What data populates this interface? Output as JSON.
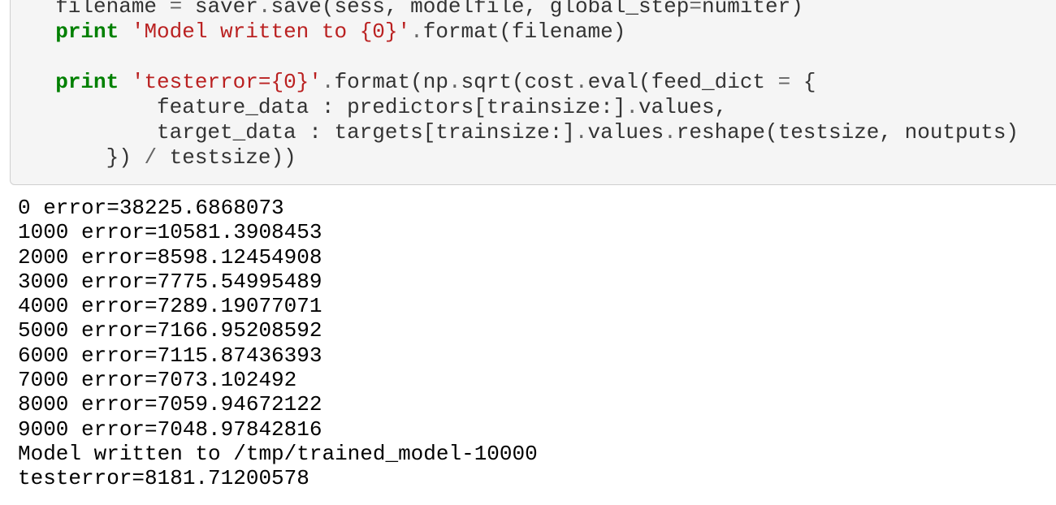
{
  "input_cell": {
    "code_lines": [
      {
        "tokens": [
          {
            "type": "text",
            "text": "  filename "
          },
          {
            "type": "op",
            "text": "="
          },
          {
            "type": "text",
            "text": " saver"
          },
          {
            "type": "op",
            "text": "."
          },
          {
            "type": "text",
            "text": "save(sess, modelfile, global_step"
          },
          {
            "type": "op",
            "text": "="
          },
          {
            "type": "text",
            "text": "numiter)"
          }
        ]
      },
      {
        "tokens": [
          {
            "type": "text",
            "text": "  "
          },
          {
            "type": "kw",
            "text": "print"
          },
          {
            "type": "text",
            "text": " "
          },
          {
            "type": "str",
            "text": "'Model written to {0}'"
          },
          {
            "type": "op",
            "text": "."
          },
          {
            "type": "text",
            "text": "format(filename)"
          }
        ]
      },
      {
        "tokens": [
          {
            "type": "text",
            "text": ""
          }
        ]
      },
      {
        "tokens": [
          {
            "type": "text",
            "text": "  "
          },
          {
            "type": "kw",
            "text": "print"
          },
          {
            "type": "text",
            "text": " "
          },
          {
            "type": "str",
            "text": "'testerror={0}'"
          },
          {
            "type": "op",
            "text": "."
          },
          {
            "type": "text",
            "text": "format(np"
          },
          {
            "type": "op",
            "text": "."
          },
          {
            "type": "text",
            "text": "sqrt(cost"
          },
          {
            "type": "op",
            "text": "."
          },
          {
            "type": "text",
            "text": "eval(feed_dict "
          },
          {
            "type": "op",
            "text": "="
          },
          {
            "type": "text",
            "text": " {"
          }
        ]
      },
      {
        "tokens": [
          {
            "type": "text",
            "text": "          feature_data : predictors[trainsize:]"
          },
          {
            "type": "op",
            "text": "."
          },
          {
            "type": "text",
            "text": "values,"
          }
        ]
      },
      {
        "tokens": [
          {
            "type": "text",
            "text": "          target_data : targets[trainsize:]"
          },
          {
            "type": "op",
            "text": "."
          },
          {
            "type": "text",
            "text": "values"
          },
          {
            "type": "op",
            "text": "."
          },
          {
            "type": "text",
            "text": "reshape(testsize, noutputs)"
          }
        ]
      },
      {
        "tokens": [
          {
            "type": "text",
            "text": "      }) "
          },
          {
            "type": "op",
            "text": "/"
          },
          {
            "type": "text",
            "text": " testsize))"
          }
        ]
      }
    ]
  },
  "output_cell": {
    "lines": [
      "0 error=38225.6868073",
      "1000 error=10581.3908453",
      "2000 error=8598.12454908",
      "3000 error=7775.54995489",
      "4000 error=7289.19077071",
      "5000 error=7166.95208592",
      "6000 error=7115.87436393",
      "7000 error=7073.102492",
      "8000 error=7059.94672122",
      "9000 error=7048.97842816",
      "Model written to /tmp/trained_model-10000",
      "testerror=8181.71200578"
    ]
  },
  "colors": {
    "keyword": "#008000",
    "string": "#ba2121",
    "operator": "#666666",
    "code_text": "#333333",
    "cell_background": "#f5f5f5",
    "cell_border": "#cfcfcf"
  }
}
